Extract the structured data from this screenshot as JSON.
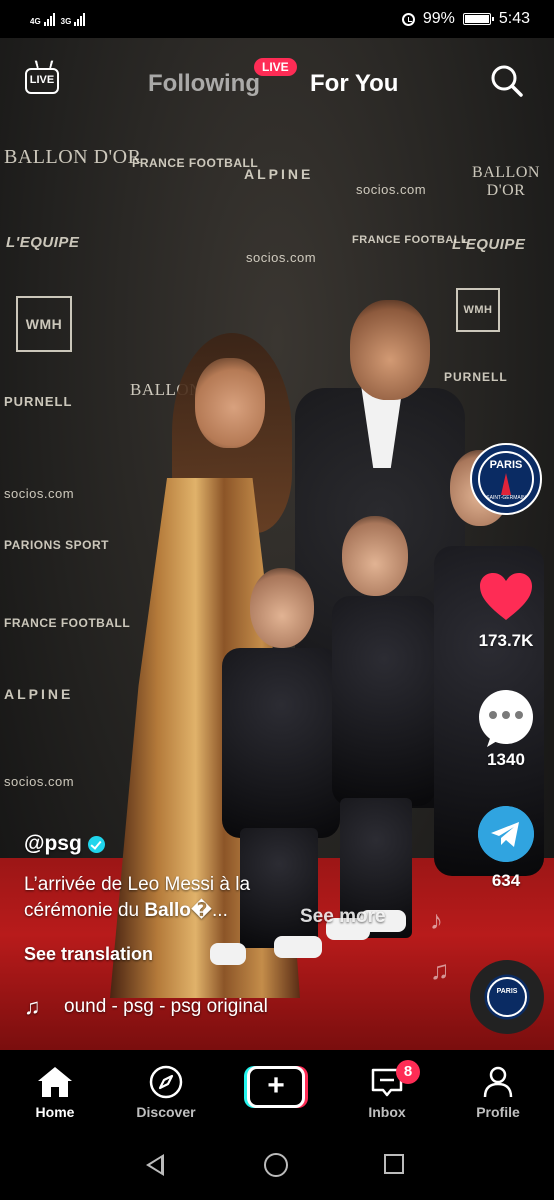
{
  "status_bar": {
    "signal_1_label": "4G",
    "signal_2_label": "3G",
    "battery_percent": "99%",
    "time": "5:43"
  },
  "top_nav": {
    "live_label": "LIVE",
    "live_badge": "LIVE",
    "tab_following": "Following",
    "tab_for_you": "For You",
    "active_tab": "For You"
  },
  "backdrop": {
    "logos": [
      "BALLON D'OR",
      "FRANCE FOOTBALL",
      "ALPINE",
      "socios.com",
      "L'EQUIPE",
      "WMH",
      "PURNELL",
      "PARIONS SPORT"
    ]
  },
  "avatar": {
    "club_text": "PARIS",
    "club_subtext": "SAINT-GERMAIN"
  },
  "actions": {
    "likes": "173.7K",
    "comments": "1340",
    "shares": "634"
  },
  "post": {
    "username": "@psg",
    "caption_line1": "L’arrivée de Leo Messi à la",
    "caption_line2_prefix": "cérémonie du ",
    "caption_line2_bold": "Ballo�",
    "caption_ellipsis": "...",
    "see_more": "See more",
    "see_translation": "See translation",
    "sound": "ound - psg - psg    original"
  },
  "disc_label": "PARIS",
  "tab_bar": {
    "home": "Home",
    "discover": "Discover",
    "create": "+",
    "inbox": "Inbox",
    "inbox_badge": "8",
    "profile": "Profile"
  },
  "colors": {
    "accent_red": "#fe2c55",
    "accent_cyan": "#25f4ee",
    "like_heart": "#fe2c55",
    "share_blue": "#30a4e0",
    "verified": "#20d5ec"
  }
}
